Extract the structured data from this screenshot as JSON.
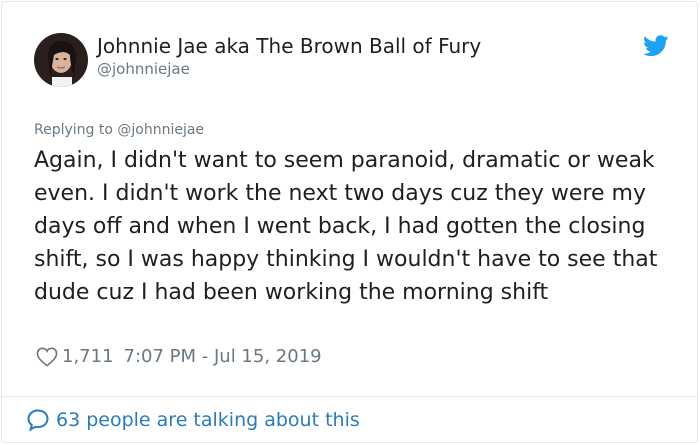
{
  "user": {
    "display_name": "Johnnie Jae aka The Brown Ball of Fury",
    "handle": "@johnniejae"
  },
  "reply": {
    "prefix": "Replying to",
    "handle": "@johnniejae"
  },
  "tweet": {
    "text": "Again, I didn't want to seem paranoid, dramatic or weak even. I didn't work the next two days cuz they were my days off and when I went back, I had gotten the closing shift, so I was happy thinking I wouldn't have to see that dude cuz I had been working the morning shift"
  },
  "meta": {
    "likes": "1,711",
    "timestamp": "7:07 PM - Jul 15, 2019"
  },
  "footer": {
    "talking": "63 people are talking about this"
  },
  "icons": {
    "bird": "twitter-bird-icon",
    "heart": "heart-icon",
    "speech": "speech-bubble-icon"
  },
  "colors": {
    "brand": "#1da1f2",
    "link": "#2b7bb9",
    "muted": "#697882",
    "text": "#1c2022"
  }
}
